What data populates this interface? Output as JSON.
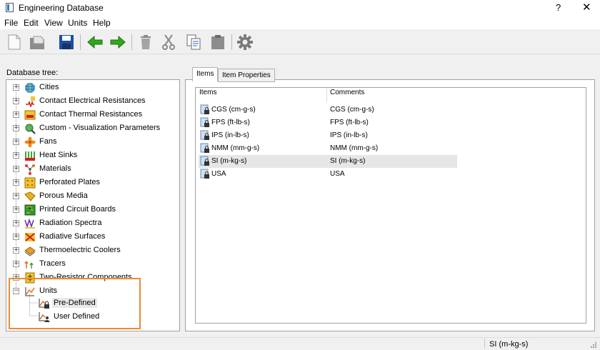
{
  "window": {
    "title": "Engineering Database",
    "help_label": "?",
    "close_label": "✕"
  },
  "menu": [
    "File",
    "Edit",
    "View",
    "Units",
    "Help"
  ],
  "toolbar": {
    "buttons": [
      "new-icon",
      "open-icon",
      "save-icon",
      "back-arrow-icon",
      "forward-arrow-icon",
      "delete-icon",
      "cut-icon",
      "copy-icon",
      "paste-icon",
      "settings-icon"
    ],
    "colors": {
      "arrow": "#34a51f",
      "save": "#1e4f9f"
    }
  },
  "tree": {
    "label": "Database tree:",
    "items": [
      {
        "label": "Cities",
        "icon": "globe-icon"
      },
      {
        "label": "Contact Electrical Resistances",
        "icon": "electrical-resistance-icon"
      },
      {
        "label": "Contact Thermal Resistances",
        "icon": "thermal-resistance-icon"
      },
      {
        "label": "Custom - Visualization Parameters",
        "icon": "visualization-icon"
      },
      {
        "label": "Fans",
        "icon": "fan-icon"
      },
      {
        "label": "Heat Sinks",
        "icon": "heat-sink-icon"
      },
      {
        "label": "Materials",
        "icon": "materials-icon"
      },
      {
        "label": "Perforated Plates",
        "icon": "perforated-plate-icon"
      },
      {
        "label": "Porous Media",
        "icon": "porous-media-icon"
      },
      {
        "label": "Printed Circuit Boards",
        "icon": "pcb-icon"
      },
      {
        "label": "Radiation Spectra",
        "icon": "spectra-icon"
      },
      {
        "label": "Radiative Surfaces",
        "icon": "radiative-surface-icon"
      },
      {
        "label": "Thermoelectric Coolers",
        "icon": "cooler-icon"
      },
      {
        "label": "Tracers",
        "icon": "tracer-icon"
      },
      {
        "label": "Two-Resistor Components",
        "icon": "two-resistor-icon"
      },
      {
        "label": "Units",
        "icon": "units-icon"
      }
    ],
    "children": [
      {
        "label": "Pre-Defined",
        "icon": "locked-units-icon",
        "selected": true
      },
      {
        "label": "User Defined",
        "icon": "user-units-icon",
        "selected": false
      }
    ],
    "highlight_color": "#ef8a2e"
  },
  "tabs": [
    {
      "label": "Items",
      "active": true
    },
    {
      "label": "Item Properties",
      "active": false
    }
  ],
  "list": {
    "columns": [
      "Items",
      "Comments"
    ],
    "rows": [
      {
        "name": "CGS (cm-g-s)",
        "comment": "CGS (cm-g-s)"
      },
      {
        "name": "FPS (ft-lb-s)",
        "comment": "FPS (ft-lb-s)"
      },
      {
        "name": "IPS (in-lb-s)",
        "comment": "IPS (in-lb-s)"
      },
      {
        "name": "NMM (mm-g-s)",
        "comment": "NMM (mm-g-s)"
      },
      {
        "name": "SI (m-kg-s)",
        "comment": "SI (m-kg-s)",
        "selected": true
      },
      {
        "name": "USA",
        "comment": "USA"
      }
    ]
  },
  "status": {
    "text": "SI (m-kg-s)"
  }
}
